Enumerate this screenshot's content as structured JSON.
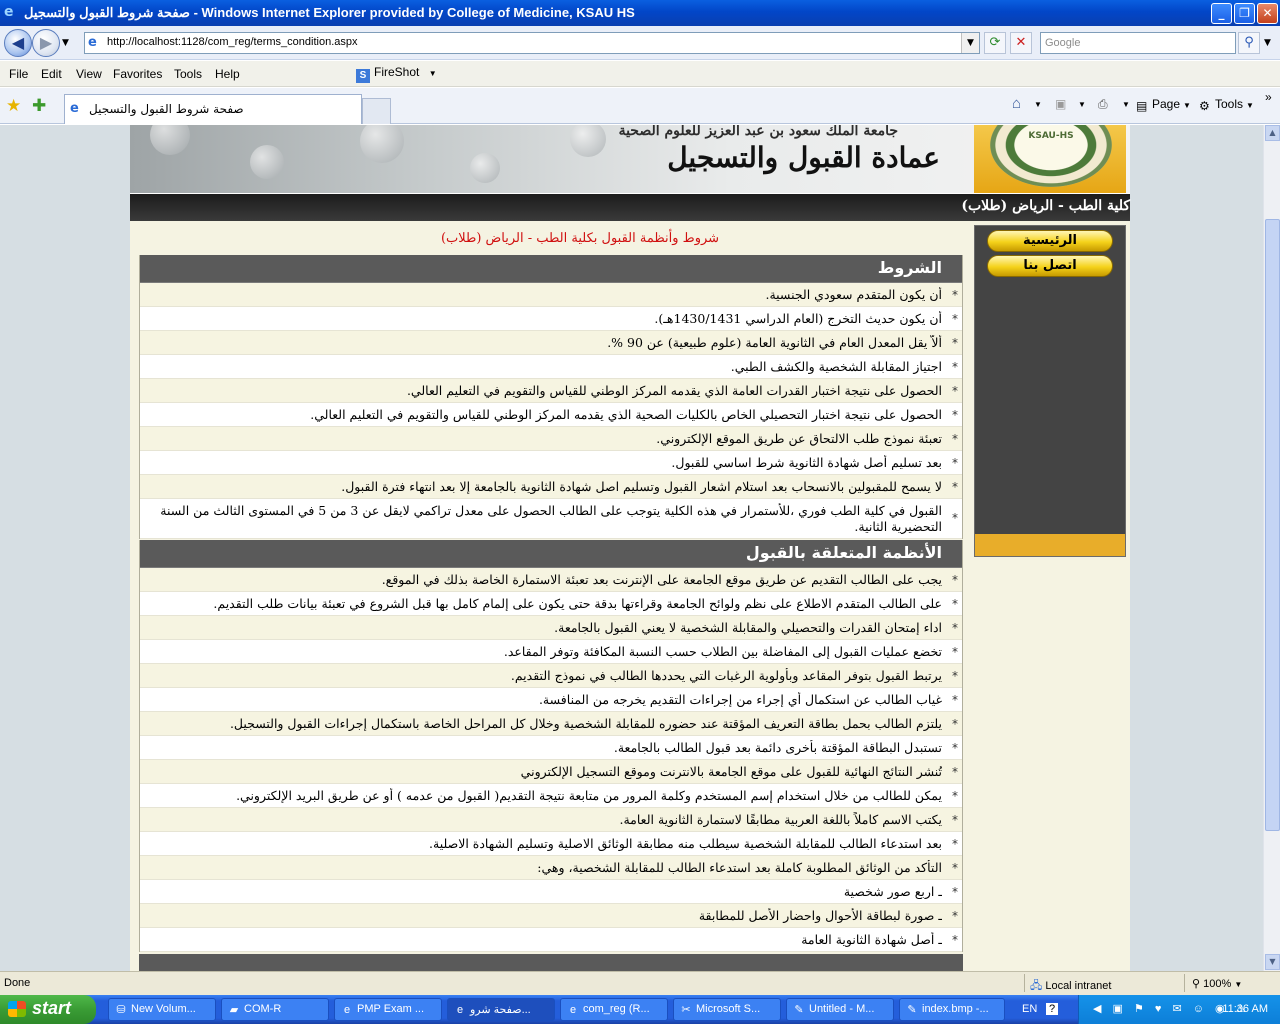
{
  "window": {
    "title": "صفحة شروط القبول والتسجيل - Windows Internet Explorer provided by College of Medicine, KSAU HS",
    "min_glyph": "_",
    "max_glyph": "❐",
    "close_glyph": "✕"
  },
  "addressbar": {
    "url": "http://localhost:1128/com_reg/terms_condition.aspx",
    "search_placeholder": "Google"
  },
  "menu": [
    "File",
    "Edit",
    "View",
    "Favorites",
    "Tools",
    "Help"
  ],
  "fireshot_label": "FireShot",
  "tab": {
    "label": "صفحة شروط القبول والتسجيل"
  },
  "toolbar": {
    "page_label": "Page",
    "tools_label": "Tools"
  },
  "banner": {
    "university": "جامعة الملك سعود بن عبد العزيز للعلوم الصحية",
    "deanship": "عمادة القبول والتسجيل",
    "college_bar": "(كلية الطب - الرياض (طلاب"
  },
  "sidebar": {
    "home_label": "الرئيسية",
    "contact_label": "اتصل بنا"
  },
  "page_heading": "شروط وأنظمة القبول بكلية الطب - الرياض (طلاب)",
  "conditions": {
    "title": "الشروط",
    "items": [
      "أن يكون المتقدم سعودي الجنسية.",
      "أن يكون حديث التخرج (العام الدراسي 1430/1431هـ).",
      "ألاّ يقل المعدل العام في الثانوية العامة (علوم طبيعية) عن 90 %.",
      "اجتياز المقابلة الشخصية والكشف الطبي.",
      "الحصول على نتيجة اختبار القدرات العامة الذي يقدمه المركز الوطني للقياس والتقويم في التعليم العالي.",
      "الحصول على نتيجة اختبار التحصيلي الخاص بالكليات الصحية الذي يقدمه المركز الوطني للقياس والتقويم في التعليم العالي.",
      "تعبئة نموذج طلب الالتحاق عن طريق الموقع الإلكتروني.",
      "بعد تسليم أصل شهادة الثانوية شرط اساسي للقبول.",
      "لا يسمح للمقبولين بالانسحاب بعد استلام اشعار القبول وتسليم اصل شهادة الثانوية بالجامعة إلا بعد انتهاء فترة القبول.",
      "القبول في كلية الطب فوري ،للأستمرار في هذه الكلية يتوجب على الطالب الحصول على معدل تراكمي لايقل عن 3 من 5 في المستوى الثالث من السنة التحضيرية الثانية."
    ]
  },
  "regulations": {
    "title": "الأنظمة المتعلقة بالقبول",
    "items": [
      "يجب على الطالب التقديم عن طريق موقع الجامعة على الإنترنت بعد تعبئة الاستمارة الخاصة بذلك في الموقع.",
      "على الطالب المتقدم الاطلاع على نظم ولوائح الجامعة وقراءتها بدقة حتى يكون على إلمام كامل بها قبل الشروع في تعبئة بيانات طلب التقديم.",
      "اداء إمتحان القدرات والتحصيلي والمقابلة الشخصية لا يعني القبول بالجامعة.",
      "تخضع عمليات القبول إلى المفاضلة بين الطلاب حسب النسبة المكافئة وتوفر المقاعد.",
      "يرتبط القبول بتوفر المقاعد وبأولوية الرغبات التي يحددها الطالب في نموذج التقديم.",
      "غياب الطالب عن استكمال أي إجراء من إجراءات التقديم يخرجه من المنافسة.",
      "يلتزم الطالب بحمل بطاقة التعريف المؤقتة عند حضوره للمقابلة الشخصية وخلال كل المراحل الخاصة باستكمال إجراءات القبول والتسجيل.",
      "تستبدل البطاقة المؤقتة بأخرى دائمة بعد قبول الطالب بالجامعة.",
      "تُنشر النتائج النهائية للقبول على موقع الجامعة بالانترنت وموقع التسجيل الإلكتروني",
      "يمكن للطالب من خلال استخدام إسم المستخدم وكلمة المرور من متابعة نتيجة التقديم( القبول من عدمه ) أو عن طريق البريد الإلكتروني.",
      "يكتب الاسم كاملاً باللغة العربية مطابقًا لاستمارة الثانوية العامة.",
      "بعد استدعاء الطالب للمقابلة الشخصية سيطلب منه مطابقة الوثائق الاصلية وتسليم الشهادة الاصلية.",
      "التأكد من الوثائق المطلوبة كاملة بعد استدعاء الطالب للمقابلة الشخصية، وهي:",
      "ـ اربع صور شخصية",
      "ـ صورة لبطاقة الأحوال واحضار الأصل للمطابقة",
      "ـ أصل شهادة الثانوية العامة"
    ]
  },
  "status": {
    "left": "Done",
    "zone": "Local intranet",
    "zoom": "100%"
  },
  "taskbar": {
    "start": "start",
    "tasks": [
      {
        "label": "New Volum...",
        "icon": "drive-icon"
      },
      {
        "label": "COM-R",
        "icon": "folder-icon"
      },
      {
        "label": "PMP Exam ...",
        "icon": "ie-icon"
      },
      {
        "label": "صفحة شرو...",
        "icon": "ie-icon"
      },
      {
        "label": "com_reg (R...",
        "icon": "ie-icon"
      },
      {
        "label": "Microsoft S...",
        "icon": "tools-icon"
      },
      {
        "label": "Untitled - M...",
        "icon": "paint-icon"
      },
      {
        "label": "index.bmp -...",
        "icon": "paint-icon"
      }
    ],
    "lang": "EN",
    "clock": "11:36 AM"
  }
}
